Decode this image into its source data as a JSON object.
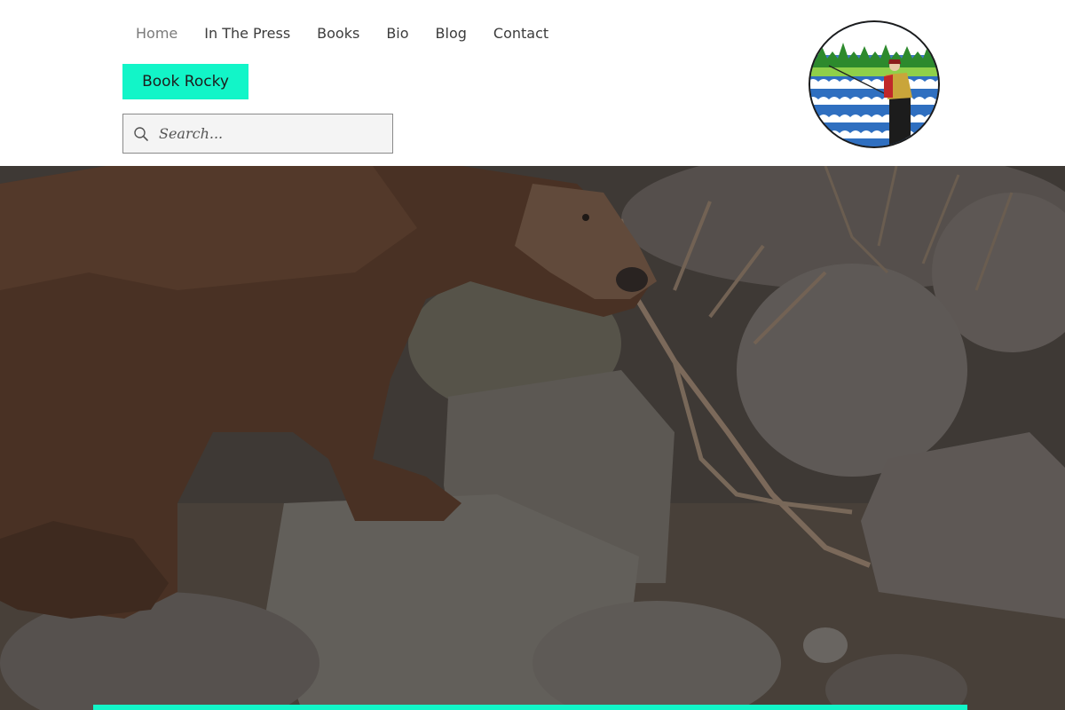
{
  "colors": {
    "accent": "#12f5c8",
    "nav_text": "#3c3c3c",
    "nav_active": "#7a7a7a"
  },
  "nav": {
    "items": [
      {
        "label": "Home",
        "active": true
      },
      {
        "label": "In The Press",
        "active": false
      },
      {
        "label": "Books",
        "active": false
      },
      {
        "label": "Bio",
        "active": false
      },
      {
        "label": "Blog",
        "active": false
      },
      {
        "label": "Contact",
        "active": false
      }
    ]
  },
  "cta": {
    "label": "Book Rocky"
  },
  "search": {
    "placeholder": "Search...",
    "icon": "search-icon"
  },
  "logo": {
    "icon": "fisherman-logo-icon"
  },
  "hero": {
    "image": "brown-bear-on-rocks-photo"
  }
}
